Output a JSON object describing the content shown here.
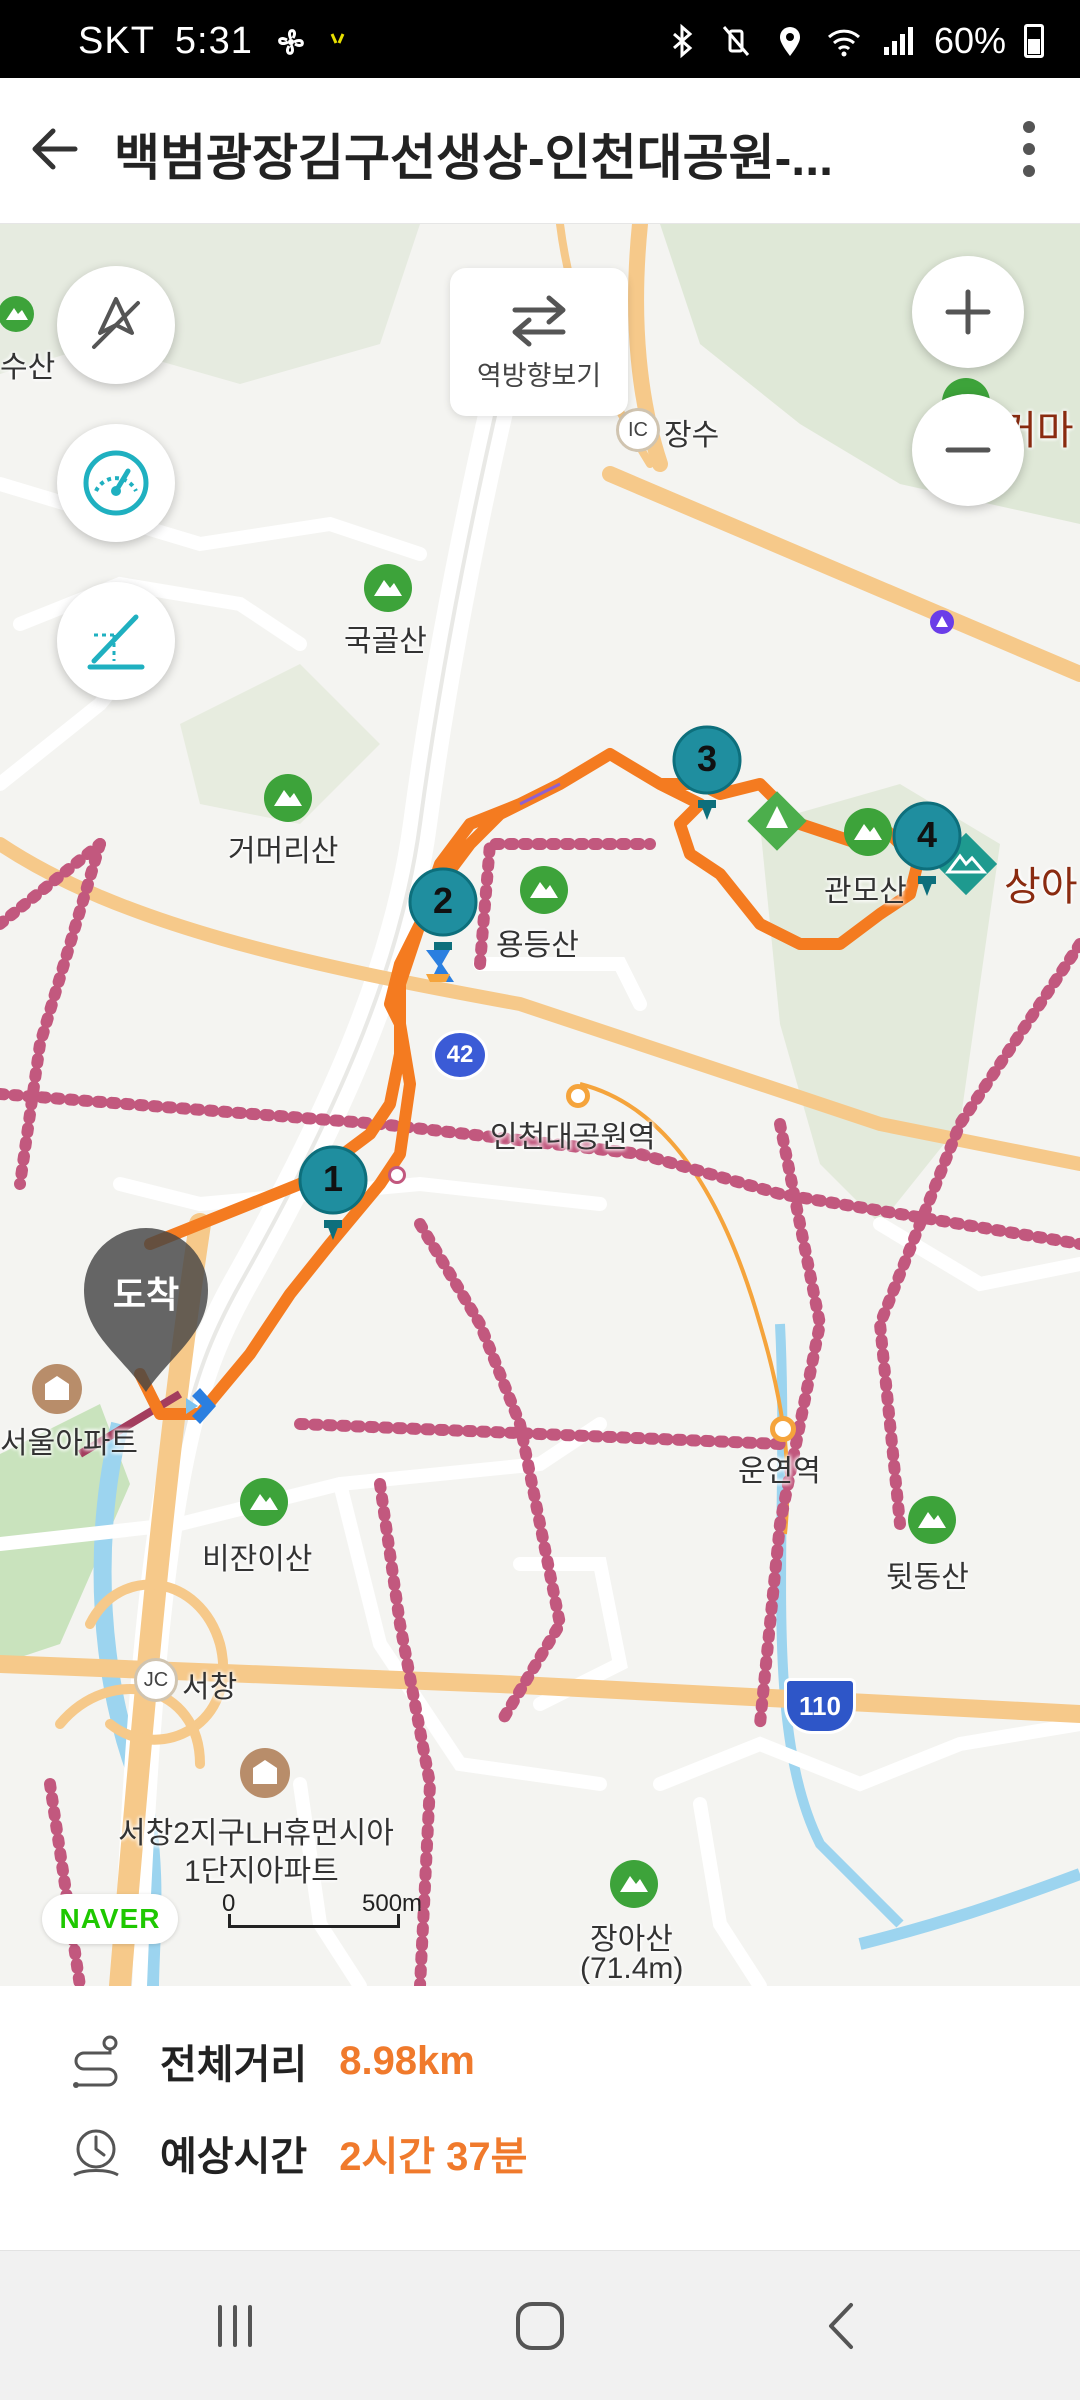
{
  "status_bar": {
    "carrier": "SKT",
    "time": "5:31",
    "battery": "60%"
  },
  "header": {
    "title": "백범광장김구선생상-인천대공원-..."
  },
  "map": {
    "reverse_button_label": "역방향보기",
    "labels": {
      "susan": "수산",
      "jangsu": "장수",
      "ic": "IC",
      "geoma": "거마",
      "gukgolsan": "국골산",
      "geomeorisan": "거머리산",
      "yongdeungsan": "용등산",
      "gwanmosan": "관모산",
      "sanga": "상아",
      "incheon_park_station": "인천대공원역",
      "arrival": "도착",
      "seoul_apt": "서울아파트",
      "unyeon_station": "운연역",
      "bijanisan": "비잔이산",
      "dwitdongsan": "뒷동산",
      "jc": "JC",
      "seochang": "서창",
      "seochang_apt_1": "서창2지구LH휴먼시아",
      "seochang_apt_2": "1단지아파트",
      "jangasan": "장아산",
      "jangasan_height": "(71.4m)"
    },
    "road_badges": {
      "route_42": "42",
      "route_110": "110"
    },
    "waypoints": [
      "1",
      "2",
      "3",
      "4"
    ],
    "naver_logo": "NAVER",
    "scale_start": "0",
    "scale_label": "500m",
    "colors": {
      "route": "#f47b20",
      "waypoint": "#1f8e9f",
      "rail": "#c2587e",
      "highway": "#f6c98a",
      "water": "#9cd4ef",
      "park": "#c9e3bd",
      "mountain": "#3da33a"
    }
  },
  "route_info": {
    "distance_label": "전체거리",
    "distance_value": "8.98km",
    "time_label": "예상시간",
    "time_value": "2시간 37분"
  },
  "icons": {
    "back": "arrow-left-icon",
    "more": "more-vertical-icon",
    "compass": "compass-off-icon",
    "speed": "speedometer-icon",
    "elevation": "elevation-profile-icon",
    "zoom_in": "plus-icon",
    "zoom_out": "minus-icon",
    "reverse": "swap-arrows-icon"
  }
}
